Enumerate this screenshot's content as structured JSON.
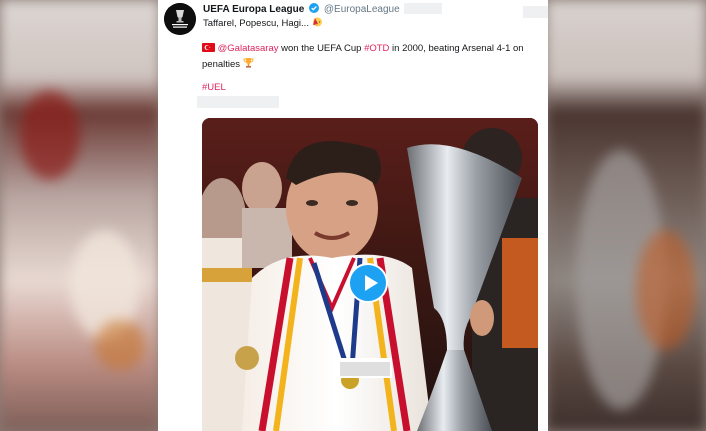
{
  "account": {
    "name": "UEFA Europa League",
    "handle": "@EuropaLeague",
    "avatar_text": "UEFA EUROPA LEAGUE"
  },
  "tweet": {
    "subtitle": "Taffarel, Popescu, Hagi...",
    "mention": "@Galatasaray",
    "text_middle": " won the UEFA Cup ",
    "hashtag_otd": "#OTD",
    "text_end": " in 2000, beating Arsenal 4-1 on penalties",
    "hashtag_uel": "#UEL"
  },
  "media": {
    "type": "video",
    "play_icon": "play-icon"
  },
  "colors": {
    "link": "#e0245e",
    "play": "#1da1f2",
    "verified": "#1da1f2"
  }
}
